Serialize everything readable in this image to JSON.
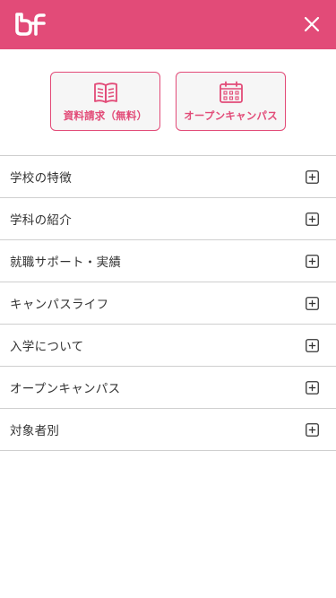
{
  "header": {
    "logo_icon": "bf-logo-icon",
    "close_icon": "close-icon",
    "background_color": "#e24b78"
  },
  "cta": {
    "brochure": {
      "label": "資料請求（無料）",
      "icon": "open-book-icon"
    },
    "open_campus": {
      "label": "オープンキャンパス",
      "icon": "calendar-icon"
    },
    "accent_color": "#e24b78"
  },
  "menu": {
    "items": [
      {
        "label": "学校の特徴",
        "icon": "plus-square-icon"
      },
      {
        "label": "学科の紹介",
        "icon": "plus-square-icon"
      },
      {
        "label": "就職サポート・実績",
        "icon": "plus-square-icon"
      },
      {
        "label": "キャンパスライフ",
        "icon": "plus-square-icon"
      },
      {
        "label": "入学について",
        "icon": "plus-square-icon"
      },
      {
        "label": "オープンキャンパス",
        "icon": "plus-square-icon"
      },
      {
        "label": "対象者別",
        "icon": "plus-square-icon"
      }
    ]
  }
}
